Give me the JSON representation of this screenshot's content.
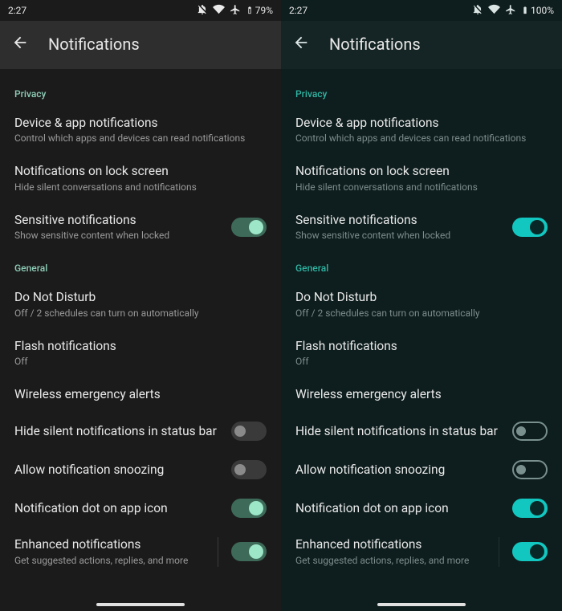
{
  "left": {
    "status": {
      "time": "2:27",
      "battery": "79%"
    },
    "header": {
      "title": "Notifications"
    },
    "sections": {
      "privacy_label": "Privacy",
      "general_label": "General",
      "items": {
        "device_app": {
          "title": "Device & app notifications",
          "sub": "Control which apps and devices can read notifications"
        },
        "lockscreen": {
          "title": "Notifications on lock screen",
          "sub": "Hide silent conversations and notifications"
        },
        "sensitive": {
          "title": "Sensitive notifications",
          "sub": "Show sensitive content when locked"
        },
        "dnd": {
          "title": "Do Not Disturb",
          "sub": "Off / 2 schedules can turn on automatically"
        },
        "flash": {
          "title": "Flash notifications",
          "sub": "Off"
        },
        "wea": {
          "title": "Wireless emergency alerts"
        },
        "hide_silent": {
          "title": "Hide silent notifications in status bar"
        },
        "snooze": {
          "title": "Allow notification snoozing"
        },
        "dot": {
          "title": "Notification dot on app icon"
        },
        "enhanced": {
          "title": "Enhanced notifications",
          "sub": "Get suggested actions, replies, and more"
        }
      }
    }
  },
  "right": {
    "status": {
      "time": "2:27",
      "battery": "100%"
    },
    "header": {
      "title": "Notifications"
    },
    "sections": {
      "privacy_label": "Privacy",
      "general_label": "General",
      "items": {
        "device_app": {
          "title": "Device & app notifications",
          "sub": "Control which apps and devices can read notifications"
        },
        "lockscreen": {
          "title": "Notifications on lock screen",
          "sub": "Hide silent conversations and notifications"
        },
        "sensitive": {
          "title": "Sensitive notifications",
          "sub": "Show sensitive content when locked"
        },
        "dnd": {
          "title": "Do Not Disturb",
          "sub": "Off / 2 schedules can turn on automatically"
        },
        "flash": {
          "title": "Flash notifications",
          "sub": "Off"
        },
        "wea": {
          "title": "Wireless emergency alerts"
        },
        "hide_silent": {
          "title": "Hide silent notifications in status bar"
        },
        "snooze": {
          "title": "Allow notification snoozing"
        },
        "dot": {
          "title": "Notification dot on app icon"
        },
        "enhanced": {
          "title": "Enhanced notifications",
          "sub": "Get suggested actions, replies, and more"
        }
      }
    }
  }
}
